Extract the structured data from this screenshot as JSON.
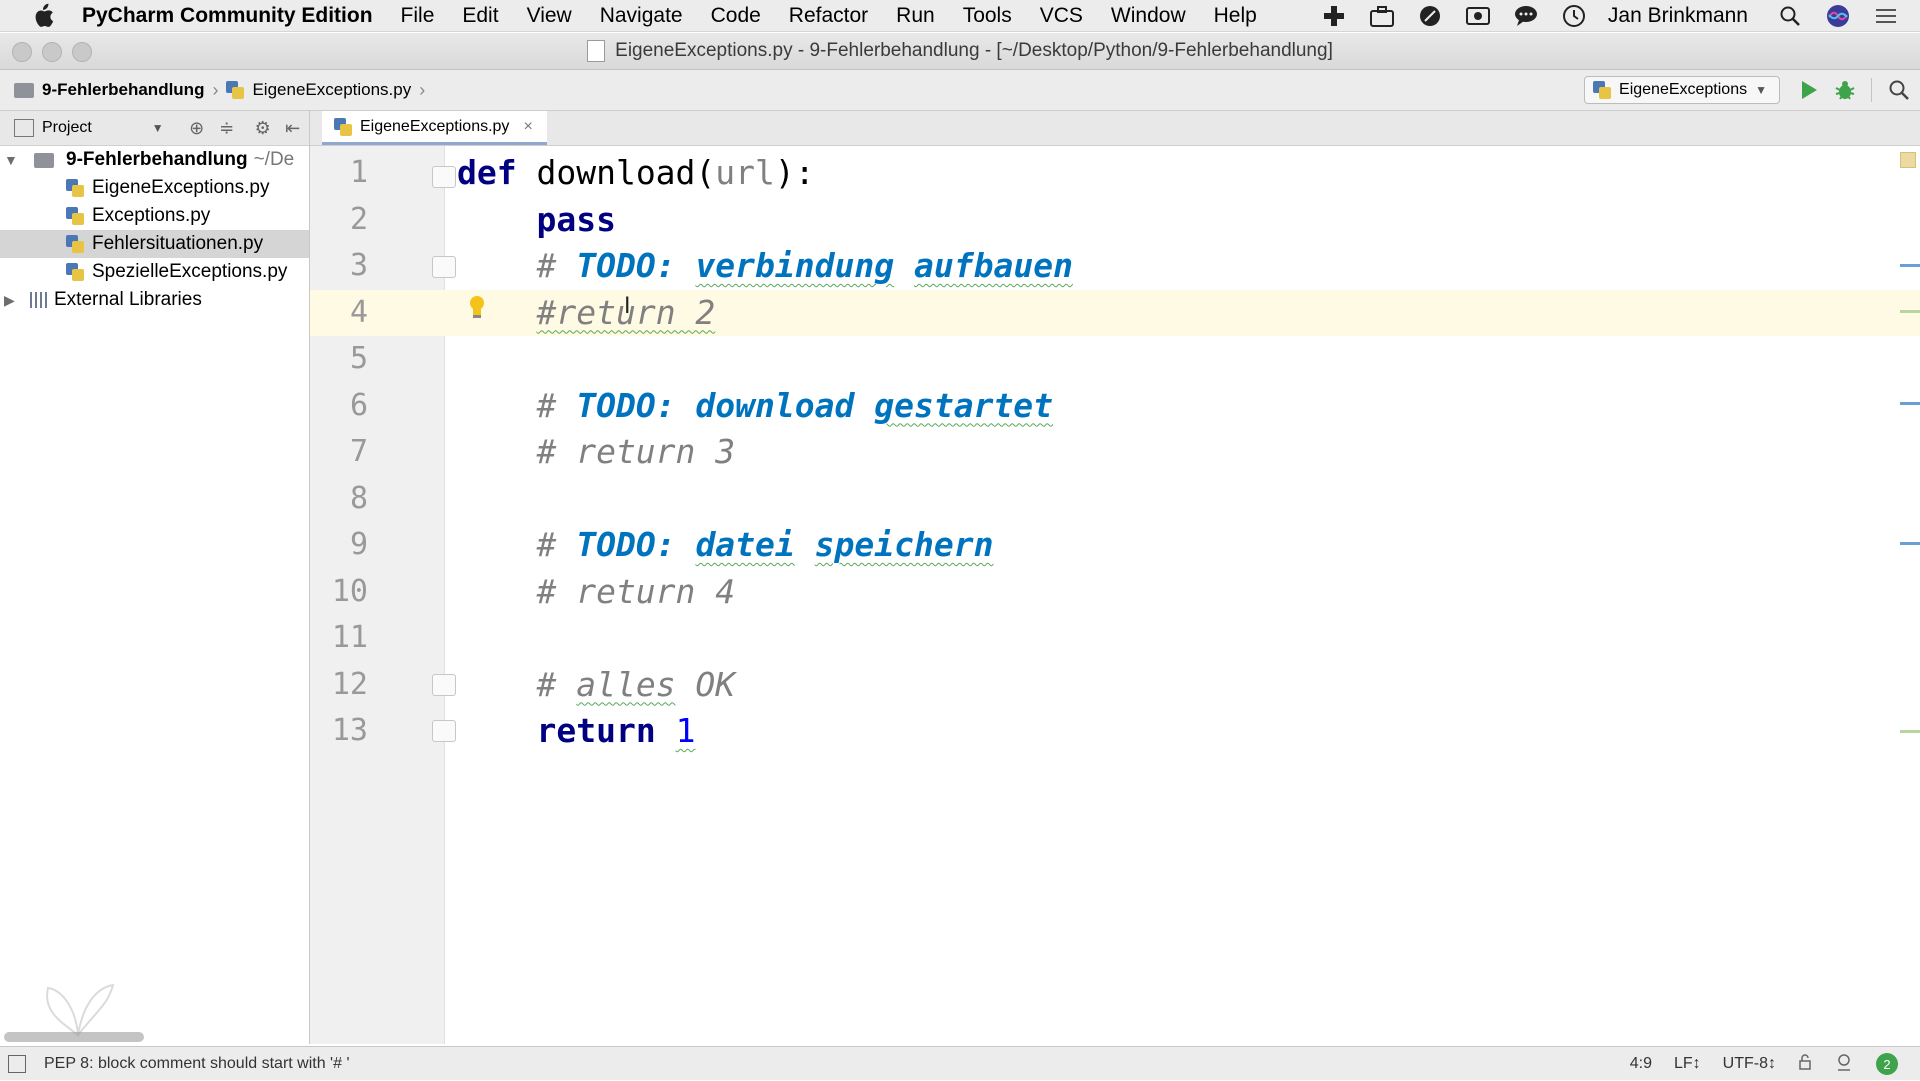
{
  "menubar": {
    "app_name": "PyCharm Community Edition",
    "items": [
      "File",
      "Edit",
      "View",
      "Navigate",
      "Code",
      "Refactor",
      "Run",
      "Tools",
      "VCS",
      "Window",
      "Help"
    ],
    "user": "Jan Brinkmann"
  },
  "window": {
    "title": "EigeneExceptions.py - 9-Fehlerbehandlung - [~/Desktop/Python/9-Fehlerbehandlung]"
  },
  "navbar": {
    "breadcrumbs": [
      "9-Fehlerbehandlung",
      "EigeneExceptions.py"
    ],
    "run_config": "EigeneExceptions"
  },
  "project_panel": {
    "label": "Project",
    "root": {
      "name": "9-Fehlerbehandlung",
      "path": "~/De"
    },
    "files": [
      "EigeneExceptions.py",
      "Exceptions.py",
      "Fehlersituationen.py",
      "SpezielleExceptions.py"
    ],
    "selected_index": 2,
    "external": "External Libraries"
  },
  "editor": {
    "tab": "EigeneExceptions.py",
    "current_line": 4,
    "lines": [
      {
        "n": "1",
        "parts": [
          {
            "t": "def",
            "c": "kw"
          },
          {
            "t": " download(",
            "c": "fn"
          },
          {
            "t": "url",
            "c": "param"
          },
          {
            "t": "):",
            "c": "fn"
          }
        ]
      },
      {
        "n": "2",
        "parts": [
          {
            "t": "    ",
            "c": "fn"
          },
          {
            "t": "pass",
            "c": "kw"
          }
        ]
      },
      {
        "n": "3",
        "parts": [
          {
            "t": "    # ",
            "c": "cm"
          },
          {
            "t": "TODO: ",
            "c": "todo"
          },
          {
            "t": "verbindung",
            "c": "todo wavy"
          },
          {
            "t": " ",
            "c": "todo"
          },
          {
            "t": "aufbauen",
            "c": "todo wavy"
          }
        ]
      },
      {
        "n": "4",
        "parts": [
          {
            "t": "    ",
            "c": "fn"
          },
          {
            "t": "#return 2",
            "c": "cm wavy"
          }
        ]
      },
      {
        "n": "5",
        "parts": []
      },
      {
        "n": "6",
        "parts": [
          {
            "t": "    # ",
            "c": "cm"
          },
          {
            "t": "TODO: download ",
            "c": "todo"
          },
          {
            "t": "gestartet",
            "c": "todo wavy"
          }
        ]
      },
      {
        "n": "7",
        "parts": [
          {
            "t": "    # return 3",
            "c": "cm"
          }
        ]
      },
      {
        "n": "8",
        "parts": []
      },
      {
        "n": "9",
        "parts": [
          {
            "t": "    # ",
            "c": "cm"
          },
          {
            "t": "TODO: ",
            "c": "todo"
          },
          {
            "t": "datei",
            "c": "todo wavy"
          },
          {
            "t": " ",
            "c": "todo"
          },
          {
            "t": "speichern",
            "c": "todo wavy"
          }
        ]
      },
      {
        "n": "10",
        "parts": [
          {
            "t": "    # return 4",
            "c": "cm"
          }
        ]
      },
      {
        "n": "11",
        "parts": []
      },
      {
        "n": "12",
        "parts": [
          {
            "t": "    # ",
            "c": "cm"
          },
          {
            "t": "alles",
            "c": "cm wavy"
          },
          {
            "t": " OK",
            "c": "cm"
          }
        ]
      },
      {
        "n": "13",
        "parts": [
          {
            "t": "    ",
            "c": "fn"
          },
          {
            "t": "return",
            "c": "kw"
          },
          {
            "t": " ",
            "c": "fn"
          },
          {
            "t": "1",
            "c": "num wavy"
          }
        ]
      }
    ]
  },
  "statusbar": {
    "message": "PEP 8: block comment should start with '# '",
    "position": "4:9",
    "line_sep": "LF↕",
    "encoding": "UTF-8↕",
    "badge": "2"
  },
  "colors": {
    "keyword": "#000080",
    "comment": "#808080",
    "todo": "#0073bf",
    "number": "#0000ff",
    "current_line": "#fffae3",
    "run_green": "#3ea34a"
  }
}
